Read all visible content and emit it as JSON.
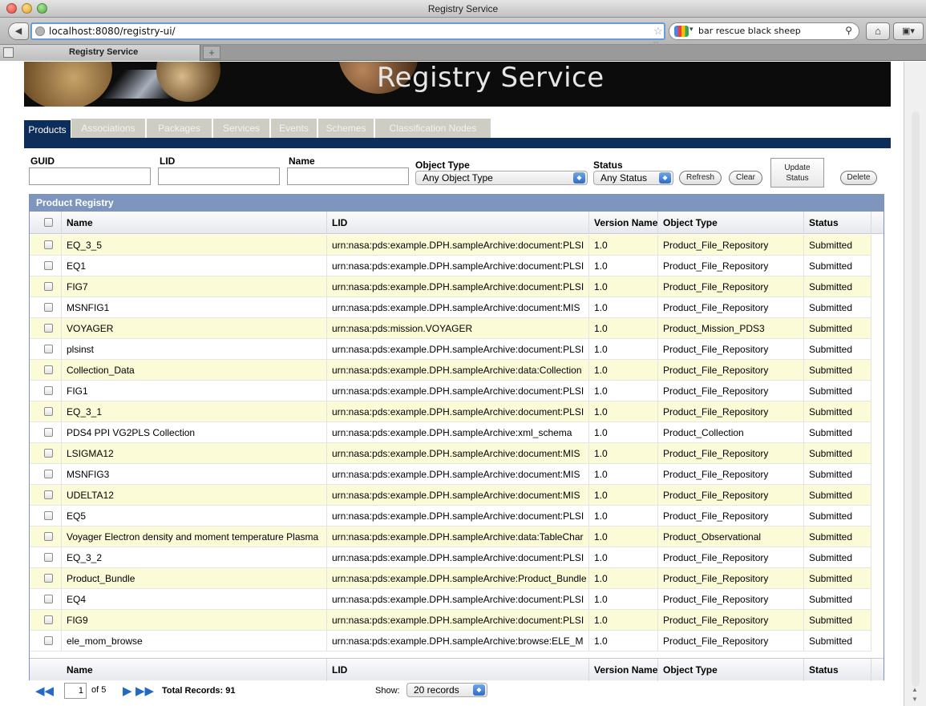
{
  "window": {
    "title": "Registry Service"
  },
  "browser": {
    "url": "localhost:8080/registry-ui/",
    "search_query": "bar rescue black sheep",
    "tab_title": "Registry Service"
  },
  "banner": {
    "title": "Registry Service"
  },
  "section_tabs": [
    "Products",
    "Associations",
    "Packages",
    "Services",
    "Events",
    "Schemes",
    "Classification Nodes"
  ],
  "active_tab": "Products",
  "filters": {
    "guid_label": "GUID",
    "lid_label": "LID",
    "name_label": "Name",
    "object_type_label": "Object Type",
    "object_type_value": "Any Object Type",
    "status_label": "Status",
    "status_value": "Any Status",
    "refresh_label": "Refresh",
    "clear_label": "Clear",
    "update_status_label_line1": "Update",
    "update_status_label_line2": "Status",
    "delete_label": "Delete"
  },
  "grid": {
    "caption": "Product Registry",
    "columns": [
      "Name",
      "LID",
      "Version Name",
      "Object Type",
      "Status"
    ],
    "rows": [
      {
        "name": "EQ_3_5",
        "lid": "urn:nasa:pds:example.DPH.sampleArchive:document:PLSI",
        "version": "1.0",
        "type": "Product_File_Repository",
        "status": "Submitted"
      },
      {
        "name": "EQ1",
        "lid": "urn:nasa:pds:example.DPH.sampleArchive:document:PLSI",
        "version": "1.0",
        "type": "Product_File_Repository",
        "status": "Submitted"
      },
      {
        "name": "FIG7",
        "lid": "urn:nasa:pds:example.DPH.sampleArchive:document:PLSI",
        "version": "1.0",
        "type": "Product_File_Repository",
        "status": "Submitted"
      },
      {
        "name": "MSNFIG1",
        "lid": "urn:nasa:pds:example.DPH.sampleArchive:document:MIS",
        "version": "1.0",
        "type": "Product_File_Repository",
        "status": "Submitted"
      },
      {
        "name": "VOYAGER",
        "lid": "urn:nasa:pds:mission.VOYAGER",
        "version": "1.0",
        "type": "Product_Mission_PDS3",
        "status": "Submitted"
      },
      {
        "name": "plsinst",
        "lid": "urn:nasa:pds:example.DPH.sampleArchive:document:PLSI",
        "version": "1.0",
        "type": "Product_File_Repository",
        "status": "Submitted"
      },
      {
        "name": "Collection_Data",
        "lid": "urn:nasa:pds:example.DPH.sampleArchive:data:Collection",
        "version": "1.0",
        "type": "Product_File_Repository",
        "status": "Submitted"
      },
      {
        "name": "FIG1",
        "lid": "urn:nasa:pds:example.DPH.sampleArchive:document:PLSI",
        "version": "1.0",
        "type": "Product_File_Repository",
        "status": "Submitted"
      },
      {
        "name": "EQ_3_1",
        "lid": "urn:nasa:pds:example.DPH.sampleArchive:document:PLSI",
        "version": "1.0",
        "type": "Product_File_Repository",
        "status": "Submitted"
      },
      {
        "name": "PDS4 PPI VG2PLS Collection",
        "lid": "urn:nasa:pds:example.DPH.sampleArchive:xml_schema",
        "version": "1.0",
        "type": "Product_Collection",
        "status": "Submitted"
      },
      {
        "name": "LSIGMA12",
        "lid": "urn:nasa:pds:example.DPH.sampleArchive:document:MIS",
        "version": "1.0",
        "type": "Product_File_Repository",
        "status": "Submitted"
      },
      {
        "name": "MSNFIG3",
        "lid": "urn:nasa:pds:example.DPH.sampleArchive:document:MIS",
        "version": "1.0",
        "type": "Product_File_Repository",
        "status": "Submitted"
      },
      {
        "name": "UDELTA12",
        "lid": "urn:nasa:pds:example.DPH.sampleArchive:document:MIS",
        "version": "1.0",
        "type": "Product_File_Repository",
        "status": "Submitted"
      },
      {
        "name": "EQ5",
        "lid": "urn:nasa:pds:example.DPH.sampleArchive:document:PLSI",
        "version": "1.0",
        "type": "Product_File_Repository",
        "status": "Submitted"
      },
      {
        "name": "Voyager Electron density and moment temperature Plasma",
        "lid": "urn:nasa:pds:example.DPH.sampleArchive:data:TableChar",
        "version": "1.0",
        "type": "Product_Observational",
        "status": "Submitted"
      },
      {
        "name": "EQ_3_2",
        "lid": "urn:nasa:pds:example.DPH.sampleArchive:document:PLSI",
        "version": "1.0",
        "type": "Product_File_Repository",
        "status": "Submitted"
      },
      {
        "name": "Product_Bundle",
        "lid": "urn:nasa:pds:example.DPH.sampleArchive:Product_Bundle",
        "version": "1.0",
        "type": "Product_File_Repository",
        "status": "Submitted"
      },
      {
        "name": "EQ4",
        "lid": "urn:nasa:pds:example.DPH.sampleArchive:document:PLSI",
        "version": "1.0",
        "type": "Product_File_Repository",
        "status": "Submitted"
      },
      {
        "name": "FIG9",
        "lid": "urn:nasa:pds:example.DPH.sampleArchive:document:PLSI",
        "version": "1.0",
        "type": "Product_File_Repository",
        "status": "Submitted"
      },
      {
        "name": "ele_mom_browse",
        "lid": "urn:nasa:pds:example.DPH.sampleArchive:browse:ELE_M",
        "version": "1.0",
        "type": "Product_File_Repository",
        "status": "Submitted"
      }
    ]
  },
  "pager": {
    "current_page": "1",
    "of_text": "of 5",
    "total_records": "Total Records: 91",
    "show_label": "Show:",
    "show_value": "20 records"
  },
  "colors": {
    "nav_dark": "#0d2e5a",
    "grid_caption": "#7e95bd",
    "row_highlight": "#fbfbd8",
    "tab_inactive": "#cdcdc4"
  }
}
